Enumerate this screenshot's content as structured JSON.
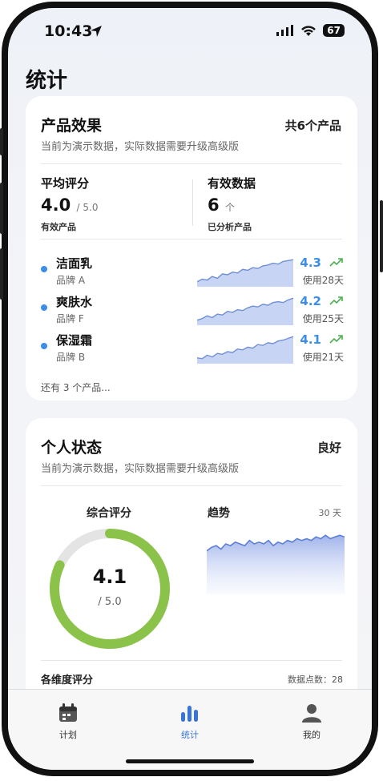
{
  "status_bar": {
    "time": "10:43",
    "battery": "67"
  },
  "page": {
    "title": "统计"
  },
  "product_card": {
    "title": "产品效果",
    "total": "共6个产品",
    "subtitle": "当前为演示数据，实际数据需要升级高级版",
    "avg": {
      "label": "平均评分",
      "value": "4.0",
      "unit": "/ 5.0",
      "foot": "有效产品"
    },
    "valid": {
      "label": "有效数据",
      "value": "6",
      "unit": "个",
      "foot": "已分析产品"
    },
    "products": [
      {
        "name": "洁面乳",
        "brand": "品牌 A",
        "score": "4.3",
        "days": "使用28天",
        "trend": [
          1.0,
          1.3,
          1.2,
          1.6,
          1.4,
          1.9,
          1.8,
          2.1,
          2.0,
          2.4,
          2.3,
          2.6,
          2.5,
          2.8,
          2.9,
          3.1,
          3.0,
          3.3,
          3.4,
          3.5
        ]
      },
      {
        "name": "爽肤水",
        "brand": "品牌 F",
        "score": "4.2",
        "days": "使用25天",
        "trend": [
          1.0,
          1.2,
          1.5,
          1.3,
          1.7,
          1.6,
          2.0,
          1.9,
          2.2,
          2.1,
          2.4,
          2.6,
          2.5,
          2.8,
          2.7,
          3.0,
          3.1,
          3.0,
          3.3,
          3.5
        ]
      },
      {
        "name": "保湿霜",
        "brand": "品牌 B",
        "score": "4.1",
        "days": "使用21天",
        "trend": [
          1.1,
          1.0,
          1.4,
          1.2,
          1.6,
          1.5,
          1.8,
          1.7,
          2.1,
          2.0,
          2.3,
          2.2,
          2.6,
          2.5,
          2.8,
          2.7,
          3.0,
          3.1,
          3.3,
          3.5
        ]
      }
    ],
    "more": "还有 3 个产品..."
  },
  "personal_card": {
    "title": "个人状态",
    "status": "良好",
    "subtitle": "当前为演示数据，实际数据需要升级高级版",
    "ring": {
      "label": "综合评分",
      "value": "4.1",
      "max": "/ 5.0",
      "fraction": 0.82,
      "color": "#8bc34a"
    },
    "trend": {
      "label": "趋势",
      "period": "30 天",
      "values": [
        3.2,
        3.4,
        3.5,
        3.3,
        3.6,
        3.5,
        3.7,
        3.6,
        3.5,
        3.8,
        3.6,
        3.7,
        3.6,
        3.8,
        3.5,
        3.7,
        3.6,
        3.8,
        3.7,
        3.9,
        3.8,
        3.9,
        3.8,
        4.0,
        3.9,
        4.1,
        3.9,
        4.0,
        4.1,
        4.0
      ]
    },
    "dimensions": {
      "label": "各维度评分",
      "count": "数据点数：28"
    }
  },
  "tabs": [
    {
      "label": "计划",
      "icon": "calendar-icon",
      "active": false
    },
    {
      "label": "统计",
      "icon": "bar-chart-icon",
      "active": true
    },
    {
      "label": "我的",
      "icon": "person-icon",
      "active": false
    }
  ],
  "colors": {
    "accent": "#3b8ee8",
    "tab_active": "#3b74d8",
    "ring": "#8bc34a",
    "trend_up": "#4caf50"
  }
}
